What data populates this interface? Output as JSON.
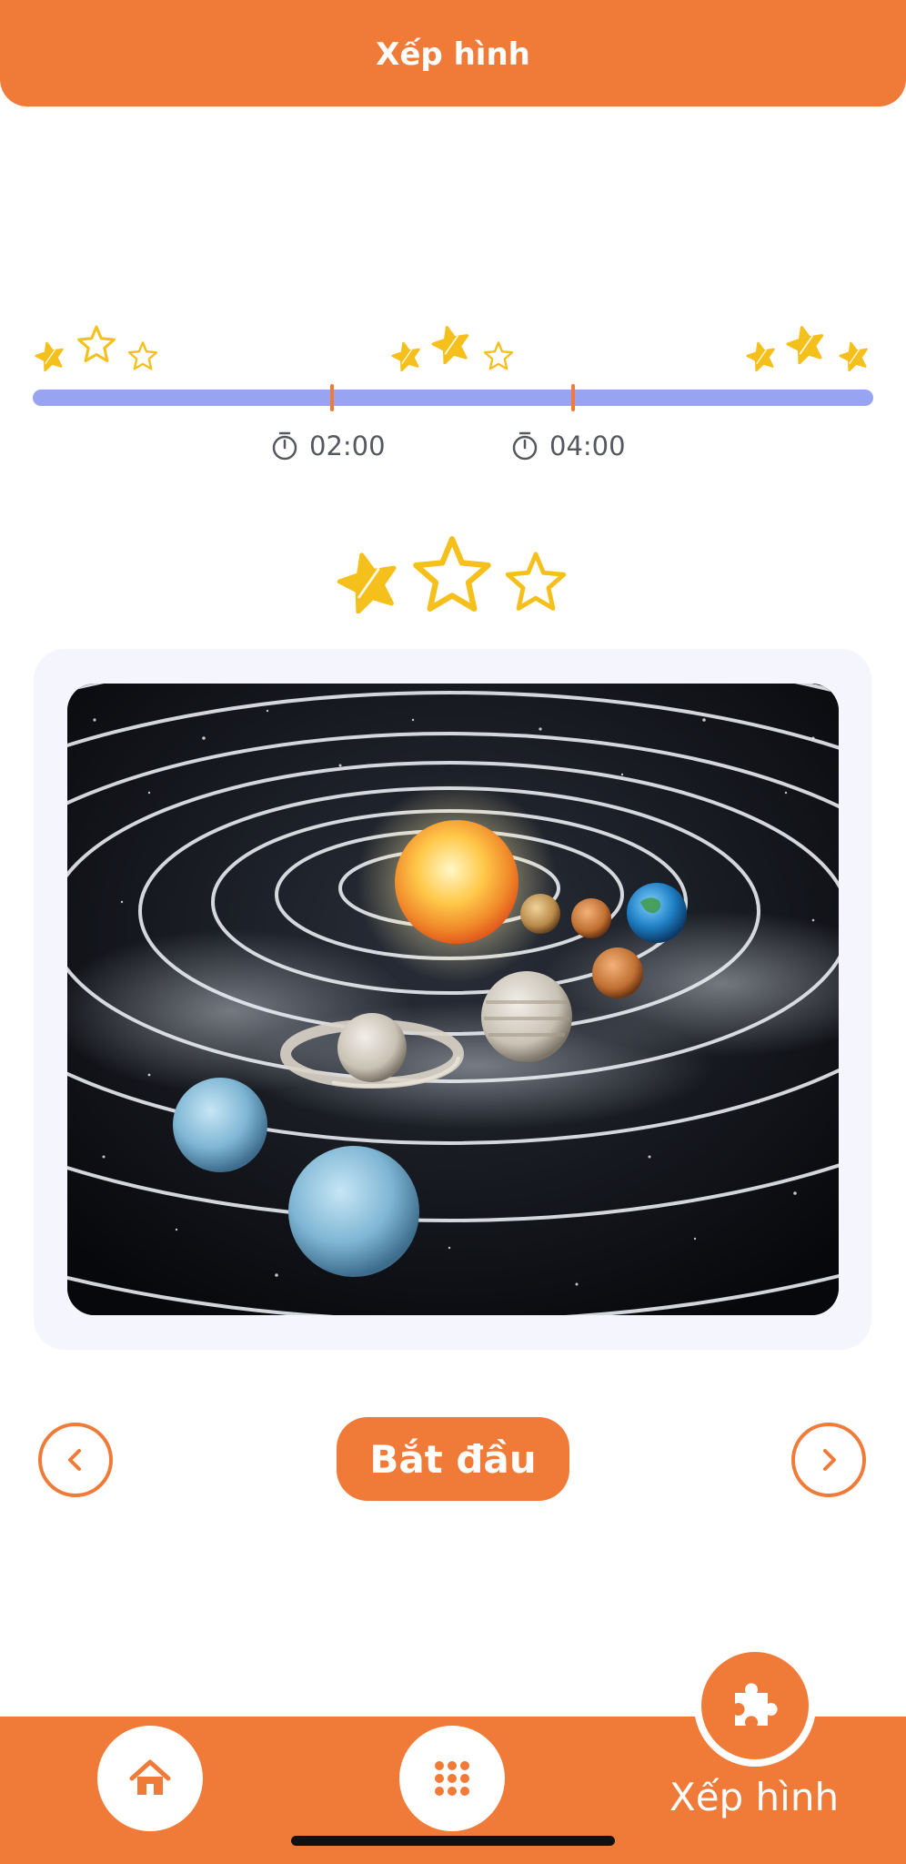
{
  "header": {
    "title": "Xếp hình"
  },
  "timeline": {
    "milestones": [
      {
        "time": "02:00"
      },
      {
        "time": "04:00"
      }
    ],
    "star_groups": [
      {
        "earned": 1,
        "total": 3
      },
      {
        "earned": 2,
        "total": 3
      },
      {
        "earned": 3,
        "total": 3
      }
    ]
  },
  "current_rating": {
    "earned": 1,
    "total": 3
  },
  "puzzle": {
    "image_icon": "solar-system-image"
  },
  "controls": {
    "prev_icon": "chevron-left-icon",
    "next_icon": "chevron-right-icon",
    "start_label": "Bắt đầu"
  },
  "bottom_nav": {
    "home_icon": "home-icon",
    "grid_icon": "grid-icon",
    "puzzle_icon": "puzzle-icon",
    "active_tab_label": "Xếp hình"
  },
  "colors": {
    "accent": "#F07B38",
    "track": "#98A4F2",
    "star": "#F5C01C",
    "card_bg": "#F4F5FD"
  }
}
